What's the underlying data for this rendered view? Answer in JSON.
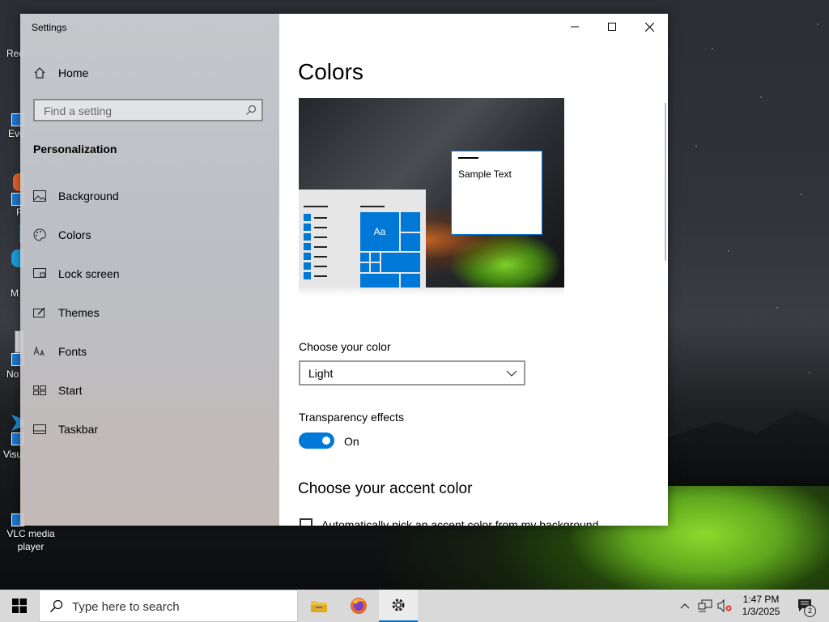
{
  "desktop": {
    "icons": [
      {
        "label": "Rec"
      },
      {
        "label": "Eve"
      },
      {
        "label": "F"
      },
      {
        "label": "M"
      },
      {
        "label": "No"
      },
      {
        "label": "Visu"
      },
      {
        "label": "VLC media player"
      }
    ]
  },
  "window": {
    "title": "Settings",
    "controls": {
      "minimize": "minimize",
      "maximize": "maximize",
      "close": "close"
    }
  },
  "sidebar": {
    "home_label": "Home",
    "search_placeholder": "Find a setting",
    "section": "Personalization",
    "items": [
      {
        "label": "Background",
        "icon": "image-icon"
      },
      {
        "label": "Colors",
        "icon": "palette-icon"
      },
      {
        "label": "Lock screen",
        "icon": "lock-screen-icon"
      },
      {
        "label": "Themes",
        "icon": "brush-icon"
      },
      {
        "label": "Fonts",
        "icon": "font-icon"
      },
      {
        "label": "Start",
        "icon": "start-icon"
      },
      {
        "label": "Taskbar",
        "icon": "taskbar-icon"
      }
    ]
  },
  "content": {
    "heading": "Colors",
    "preview": {
      "sample_text": "Sample Text",
      "tile_text": "Aa"
    },
    "choose_color_label": "Choose your color",
    "choose_color_value": "Light",
    "transparency_label": "Transparency effects",
    "transparency_state": "On",
    "accent_heading": "Choose your accent color",
    "auto_pick_label": "Automatically pick an accent color from my background"
  },
  "taskbar": {
    "search_placeholder": "Type here to search",
    "apps": [
      "file-explorer-icon",
      "firefox-icon",
      "settings-icon"
    ],
    "time": "1:47 PM",
    "date": "1/3/2025",
    "notification_count": "2"
  },
  "colors": {
    "accent": "#0078d7",
    "taskbar": "#d9d9d9"
  }
}
